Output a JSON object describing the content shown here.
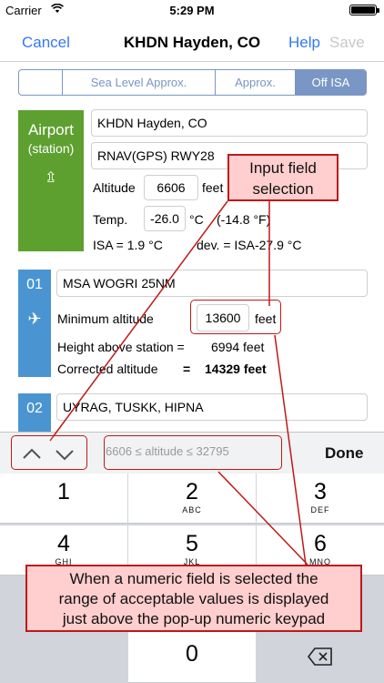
{
  "status_bar": {
    "carrier": "Carrier",
    "time": "5:29 PM"
  },
  "nav": {
    "cancel": "Cancel",
    "title": "KHDN Hayden, CO",
    "help": "Help",
    "save": "Save"
  },
  "segments": [
    "",
    "Sea Level Approx.",
    "Approx.",
    "Off ISA"
  ],
  "airport": {
    "label1": "Airport",
    "label2": "(station)",
    "name": "KHDN Hayden, CO",
    "approach": "RNAV(GPS) RWY28",
    "altitude_label": "Altitude",
    "altitude_value": "6606",
    "altitude_unit": "feet",
    "temp_label": "Temp.",
    "temp_value": "-26.0",
    "temp_unit": "°C",
    "temp_f": "(-14.8 °F)",
    "isa": "ISA = 1.9 °C",
    "dev": "dev. = ISA-27.9 °C"
  },
  "waypoint1": {
    "number": "01",
    "name": "MSA WOGRI 25NM",
    "min_alt_label": "Minimum altitude",
    "min_alt_value": "13600",
    "min_alt_unit": "feet",
    "height_label": "Height above station =",
    "height_value": "6994 feet",
    "corrected_label": "Corrected altitude",
    "corrected_eq": "=",
    "corrected_value": "14329 feet"
  },
  "waypoint2": {
    "number": "02",
    "name": "UYRAG, TUSKK, HIPNA"
  },
  "annotations": {
    "input_selection": [
      "Input field",
      "selection"
    ],
    "range_note": [
      "When a numeric field is selected the",
      "range of acceptable values is displayed",
      "just above the pop-up numeric keypad"
    ]
  },
  "accessory": {
    "range_text": "6606  ≤  altitude  ≤  32795",
    "done": "Done"
  },
  "keypad": [
    {
      "digit": "1",
      "letters": ""
    },
    {
      "digit": "2",
      "letters": "ABC"
    },
    {
      "digit": "3",
      "letters": "DEF"
    },
    {
      "digit": "4",
      "letters": "GHI"
    },
    {
      "digit": "5",
      "letters": "JKL"
    },
    {
      "digit": "6",
      "letters": "MNO"
    },
    {
      "digit": "0",
      "letters": ""
    }
  ],
  "colors": {
    "accent": "#3478f6",
    "airport": "#5ea030",
    "waypoint": "#4a95d1",
    "annotation": "#c01818",
    "annotation_fill": "#ffcece"
  }
}
